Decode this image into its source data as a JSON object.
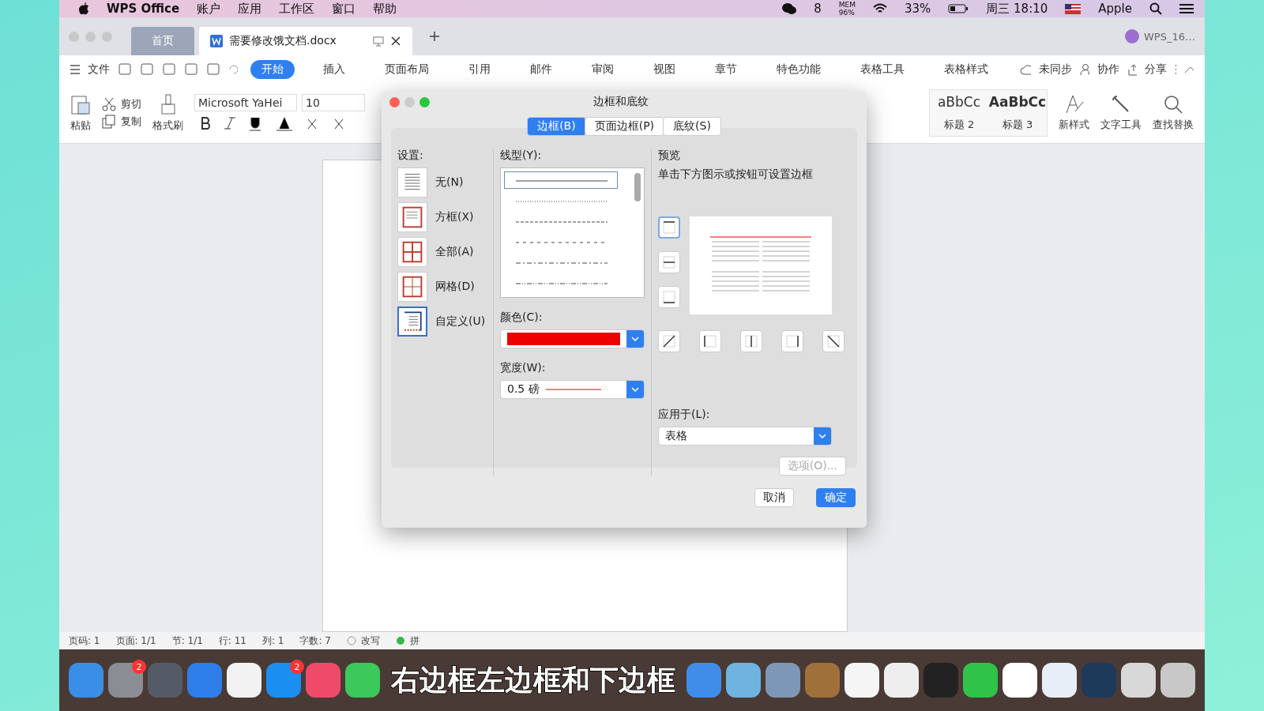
{
  "menubar": {
    "app": "WPS Office",
    "items": [
      "账户",
      "应用",
      "工作区",
      "窗口",
      "帮助"
    ],
    "wechat_count": "8",
    "mem_label": "MEM",
    "mem": "96%",
    "battery": "33%",
    "clock": "周三 18:10",
    "user": "Apple"
  },
  "tabs": [
    {
      "label": "首页",
      "kind": "home",
      "selected": false
    },
    {
      "label": "需要修改饿文档.docx",
      "kind": "doc",
      "selected": true
    }
  ],
  "account": "WPS_16…",
  "toolbar": {
    "file_menu": "文件",
    "ribbon_tabs": [
      {
        "label": "开始",
        "selected": true
      },
      {
        "label": "插入",
        "selected": false
      },
      {
        "label": "页面布局",
        "selected": false
      },
      {
        "label": "引用",
        "selected": false
      },
      {
        "label": "邮件",
        "selected": false
      },
      {
        "label": "审阅",
        "selected": false
      },
      {
        "label": "视图",
        "selected": false
      },
      {
        "label": "章节",
        "selected": false
      },
      {
        "label": "特色功能",
        "selected": false
      },
      {
        "label": "表格工具",
        "selected": false
      },
      {
        "label": "表格样式",
        "selected": false
      }
    ],
    "sync": "未同步",
    "collab": "协作",
    "share": "分享"
  },
  "ribbon": {
    "paste": "粘贴",
    "cut": "剪切",
    "copy": "复制",
    "format_painter": "格式刷",
    "font": "Microsoft YaHei",
    "size": "10",
    "styles": [
      {
        "sample": "aBbCc",
        "label": "标题 2"
      },
      {
        "sample": "AaBbCc",
        "label": "标题 3"
      }
    ],
    "new_style": "新样式",
    "text_tools": "文字工具",
    "find_replace": "查找替换"
  },
  "dialog": {
    "title": "边框和底纹",
    "tabs": [
      {
        "label": "边框(B)",
        "selected": true
      },
      {
        "label": "页面边框(P)",
        "selected": false
      },
      {
        "label": "底纹(S)",
        "selected": false
      }
    ],
    "settings_label": "设置:",
    "settings": [
      {
        "label": "无(N)",
        "kind": "none",
        "selected": false
      },
      {
        "label": "方框(X)",
        "kind": "box",
        "selected": false
      },
      {
        "label": "全部(A)",
        "kind": "all",
        "selected": false
      },
      {
        "label": "网格(D)",
        "kind": "grid",
        "selected": false
      },
      {
        "label": "自定义(U)",
        "kind": "custom",
        "selected": true
      }
    ],
    "line_style_label": "线型(Y):",
    "line_styles": [
      {
        "kind": "solid",
        "selected": true
      },
      {
        "kind": "dotted",
        "selected": false
      },
      {
        "kind": "dashed",
        "selected": false
      },
      {
        "kind": "sparse",
        "selected": false
      },
      {
        "kind": "dashdot",
        "selected": false
      },
      {
        "kind": "dashdotdot",
        "selected": false
      }
    ],
    "color_label": "颜色(C):",
    "color": "#ee0000",
    "width_label": "宽度(W):",
    "width_value": "0.5",
    "width_unit": "磅",
    "preview_label": "预览",
    "preview_hint": "单击下方图示或按钮可设置边框",
    "side_buttons": [
      {
        "kind": "top",
        "on": true
      },
      {
        "kind": "hmid",
        "on": false
      },
      {
        "kind": "bottom",
        "on": false
      }
    ],
    "bottom_buttons": [
      {
        "kind": "diagup",
        "on": false
      },
      {
        "kind": "left",
        "on": false
      },
      {
        "kind": "vmid",
        "on": false
      },
      {
        "kind": "right",
        "on": false
      },
      {
        "kind": "diagdown",
        "on": false
      }
    ],
    "apply_label": "应用于(L):",
    "apply_value": "表格",
    "options_button": {
      "label": "选项(O)...",
      "disabled": true
    },
    "cancel": "取消",
    "ok": "确定"
  },
  "status_bar": [
    "页码: 1",
    "页面: 1/1",
    "节: 1/1",
    "行: 11",
    "列: 1",
    "字数: 7"
  ],
  "overwrite": "改写",
  "spell": "拼",
  "dock": [
    {
      "color": "#3a8ee6"
    },
    {
      "color": "#8a8d93",
      "badge": "2"
    },
    {
      "color": "#555b66"
    },
    {
      "color": "#2d7ee8"
    },
    {
      "color": "#f2f2f2"
    },
    {
      "color": "#1b8ef2",
      "badge": "2"
    },
    {
      "color": "#f04a6a"
    },
    {
      "color": "#3cc85a"
    },
    {
      "color": "#3f8de8"
    },
    {
      "color": "#6fb3e0"
    },
    {
      "color": "#7d97b8"
    },
    {
      "color": "#a0703a"
    },
    {
      "color": "#f5f5f5"
    },
    {
      "color": "#eeeeee"
    },
    {
      "color": "#222222"
    },
    {
      "color": "#2fc34a"
    },
    {
      "color": "#ffffff"
    },
    {
      "color": "#e8eef8"
    },
    {
      "color": "#1e3a5a"
    },
    {
      "color": "#d8d8d8"
    },
    {
      "color": "#c8c8c8"
    }
  ],
  "subtitle": "右边框左边框和下边框"
}
